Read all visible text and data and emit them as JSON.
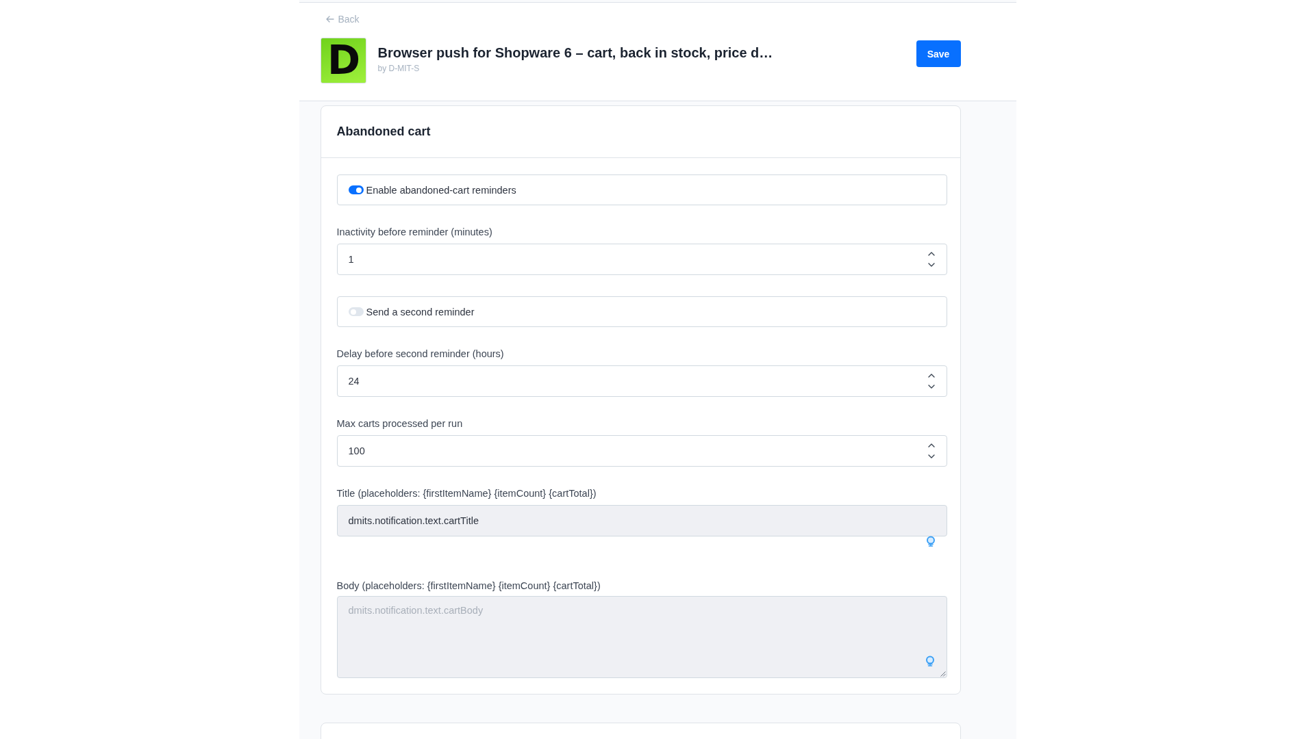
{
  "back_link": {
    "label": "Back"
  },
  "plugin": {
    "logo_letter": "D",
    "title": "Browser push for Shopware 6 – cart, back in stock, price d…",
    "vendor": "by D-MIT-S"
  },
  "save_button": {
    "label": "Save"
  },
  "card": {
    "title": "Abandoned cart",
    "fields": [
      {
        "kind": "switch",
        "label": "Enable abandoned-cart reminders",
        "on": true
      },
      {
        "kind": "number",
        "label": "Inactivity before reminder (minutes)",
        "value": "1"
      },
      {
        "kind": "switch",
        "label": "Send a second reminder",
        "on": false
      },
      {
        "kind": "number",
        "label": "Delay before second reminder (hours)",
        "value": "24"
      },
      {
        "kind": "number",
        "label": "Max carts processed per run",
        "value": "100"
      },
      {
        "kind": "text",
        "label": "Title (placeholders: {firstItemName} {itemCount} {cartTotal})",
        "value": "dmits.notification.text.cartTitle",
        "disabled": true
      },
      {
        "kind": "textarea",
        "label": "Body (placeholders: {firstItemName} {itemCount} {cartTotal})",
        "placeholder": "dmits.notification.text.cartBody",
        "disabled": true
      }
    ]
  }
}
